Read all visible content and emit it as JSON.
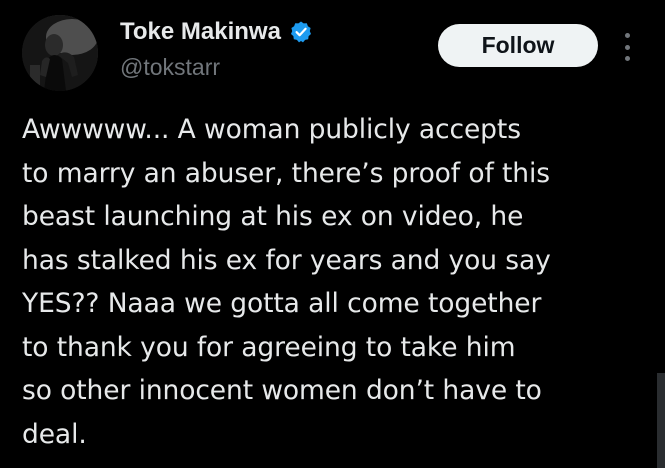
{
  "author": {
    "display_name": "Toke Makinwa",
    "handle": "@tokstarr",
    "verified": true,
    "verified_color": "#1d9bf0"
  },
  "actions": {
    "follow_label": "Follow",
    "more_icon": "more-vertical-icon"
  },
  "tweet": {
    "lines": [
      "Awwwww... A woman publicly accepts",
      "to marry an abuser, there’s proof of this",
      "beast launching at his ex on video, he",
      "has stalked his ex for years and you say",
      "YES?? Naaa we gotta all come together",
      "to thank you for agreeing to take him",
      "so other innocent women don’t have to",
      "deal."
    ]
  },
  "colors": {
    "background": "#000000",
    "text": "#e7e9ea",
    "secondary_text": "#71767b",
    "button_bg": "#eff3f4",
    "button_text": "#0f1419"
  }
}
